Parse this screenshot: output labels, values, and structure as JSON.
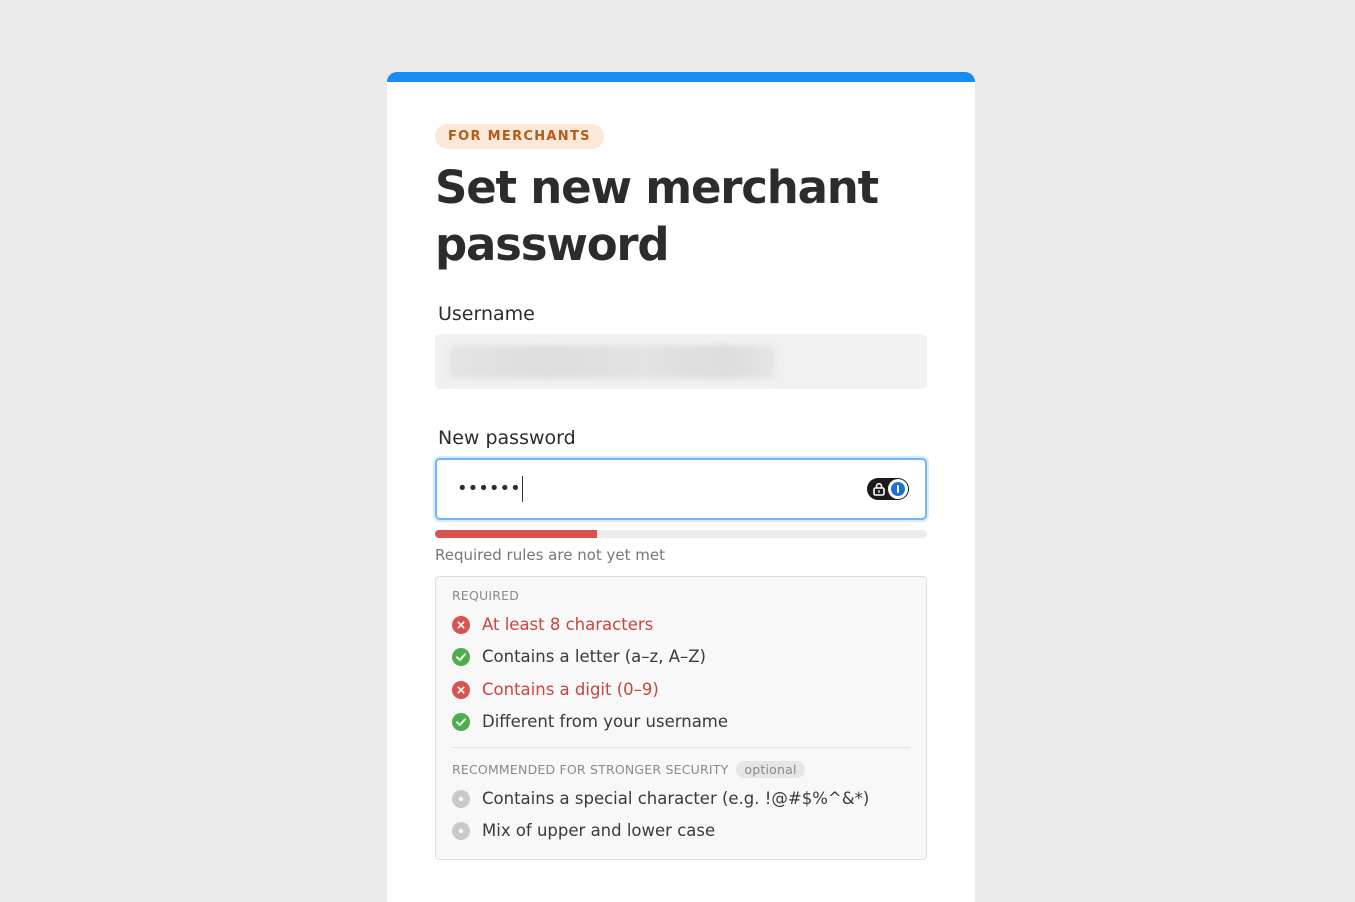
{
  "badge": "FOR MERCHANTS",
  "title": "Set new merchant password",
  "username": {
    "label": "Username"
  },
  "password": {
    "label": "New password",
    "masked_value": "••••••",
    "manager_icon": "password-manager-toggle-icon"
  },
  "strength": {
    "fraction": 0.33,
    "status_text": "Required rules are not yet met",
    "color": "#d9534f"
  },
  "rules": {
    "required_heading": "REQUIRED",
    "required": [
      {
        "text": "At least 8 characters",
        "state": "fail"
      },
      {
        "text": "Contains a letter (a–z, A–Z)",
        "state": "pass"
      },
      {
        "text": "Contains a digit (0–9)",
        "state": "fail"
      },
      {
        "text": "Different from your username",
        "state": "pass"
      }
    ],
    "recommended_heading": "RECOMMENDED FOR STRONGER SECURITY",
    "optional_label": "optional",
    "recommended": [
      {
        "text": "Contains a special character (e.g. !@#$%^&*)",
        "state": "neutral"
      },
      {
        "text": "Mix of upper and lower case",
        "state": "neutral"
      }
    ]
  },
  "colors": {
    "accent": "#1a8cf0",
    "fail": "#d9534f",
    "pass": "#4cae4c",
    "neutral": "#c9c9c9",
    "badge_bg": "#fbe8d8",
    "badge_text": "#b45a1a"
  }
}
